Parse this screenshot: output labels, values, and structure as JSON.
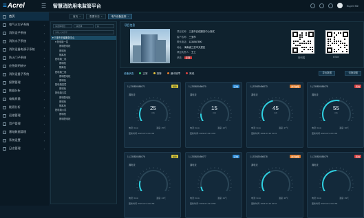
{
  "header": {
    "logo_prefix": "≡",
    "logo": "Acrel",
    "title": "智慧消防用电监管平台",
    "user": "Super Me"
  },
  "sidebar": [
    {
      "label": "首页",
      "arrow": ""
    },
    {
      "label": "电气火灾子系统",
      "arrow": "›"
    },
    {
      "label": "消防设子系统",
      "arrow": "›"
    },
    {
      "label": "消防水子系统",
      "arrow": "›"
    },
    {
      "label": "消防设备电源子系统",
      "arrow": "›"
    },
    {
      "label": "防火门子系统",
      "arrow": "›"
    },
    {
      "label": "应急照明统计",
      "arrow": "›"
    },
    {
      "label": "消防设备子系统",
      "arrow": "›"
    },
    {
      "label": "报警管理",
      "arrow": "›"
    },
    {
      "label": "数据分析",
      "arrow": "›"
    },
    {
      "label": "电能质量",
      "arrow": "›"
    },
    {
      "label": "能源分析",
      "arrow": "›"
    },
    {
      "label": "运维管理",
      "arrow": "›"
    },
    {
      "label": "用户管理",
      "arrow": "›"
    },
    {
      "label": "基础数据管理",
      "arrow": "›"
    },
    {
      "label": "系统设置",
      "arrow": "›"
    },
    {
      "label": "日志管理",
      "arrow": "›"
    }
  ],
  "tabs": [
    {
      "label": "首页"
    },
    {
      "label": "配置状态"
    },
    {
      "label": "电气设备监测"
    }
  ],
  "tree": {
    "filters": [
      "请选择项目",
      "请选择",
      "请"
    ],
    "search_placeholder": "请输入关键字",
    "nodes": [
      {
        "label": "▾ 三亚市白保服务中心",
        "indent": 2,
        "sel": true
      },
      {
        "label": "▾ 配电箱一层",
        "indent": 6
      },
      {
        "label": "照明配电柜",
        "indent": 12
      },
      {
        "label": "照明柜",
        "indent": 12
      },
      {
        "label": "隔离柜",
        "indent": 12
      },
      {
        "label": "配电箱二层",
        "indent": 6
      },
      {
        "label": "照明柜",
        "indent": 12
      },
      {
        "label": "隔离柜",
        "indent": 12
      },
      {
        "label": "配电箱三层",
        "indent": 6
      },
      {
        "label": "照明配电柜",
        "indent": 12
      },
      {
        "label": "照明柜",
        "indent": 12
      },
      {
        "label": "配电箱四层",
        "indent": 6
      },
      {
        "label": "照明柜",
        "indent": 12
      },
      {
        "label": "配电箱五层",
        "indent": 6
      },
      {
        "label": "照明配电柜",
        "indent": 12
      },
      {
        "label": "照明柜",
        "indent": 12
      },
      {
        "label": "隔离柜",
        "indent": 12
      },
      {
        "label": "配电箱六层",
        "indent": 6
      },
      {
        "label": "照明柜",
        "indent": 12
      },
      {
        "label": "照明配电柜",
        "indent": 12
      }
    ]
  },
  "info": {
    "title": "项目信息",
    "rows": [
      {
        "k": "项目名称:",
        "v": "三亚市白保服务中心测试"
      },
      {
        "k": "客户名称:",
        "v": "三亚市"
      },
      {
        "k": "联系电话:",
        "v": "1234567890"
      },
      {
        "k": "地址:",
        "v": "海南省三亚市天涯区"
      },
      {
        "k": "项目负责人:",
        "v": "王工"
      },
      {
        "k": "状态:",
        "v": "正常"
      }
    ],
    "qr1_caption": "安科瑞",
    "qr2_caption": "ESIM"
  },
  "status": {
    "label": "设备状态",
    "legend": [
      {
        "label": "正常",
        "color": "#3cc86b"
      },
      {
        "label": "报警",
        "color": "#e7c33a"
      },
      {
        "label": "通讯故障",
        "color": "#e07b2a"
      },
      {
        "label": "离线",
        "color": "#d94040"
      }
    ],
    "btn_export": "导出数据",
    "btn_switch": "切换视图"
  },
  "cards": [
    {
      "title": "1 | 230820456071",
      "badge": "报警",
      "btype": "ok",
      "label": "漏电流",
      "value": "25",
      "unit": "mA",
      "frac": 0.25,
      "r1": "电流: 0mA",
      "r2": "温度: 25℃",
      "r3": "更新时间: 2023-07-24 11:03"
    },
    {
      "title": "1 | 230820456070",
      "badge": "正常",
      "btype": "cm",
      "label": "漏电流",
      "value": "15",
      "unit": "mA",
      "frac": 0.15,
      "r1": "电流: 0mA",
      "r2": "温度: 22℃",
      "r3": "更新时间: 2023-07-24 11:02"
    },
    {
      "title": "1 | 230820456073",
      "badge": "通讯故障",
      "btype": "or",
      "label": "漏电流",
      "value": "45",
      "unit": "mA",
      "frac": 0.45,
      "r1": "电流: 0mA",
      "r2": "温度: 27℃",
      "r3": "更新时间: 2023-07-24 11:01"
    },
    {
      "title": "1 | 230820456075",
      "badge": "离线",
      "btype": "rd",
      "label": "漏电流",
      "value": "55",
      "unit": "mA",
      "frac": 0.55,
      "r1": "电流: 0mA",
      "r2": "温度: 30℃",
      "r3": "更新时间: 2023-07-24 11:00"
    },
    {
      "title": "1 | 230820456076",
      "badge": "报警",
      "btype": "ok",
      "label": "漏电流",
      "value": "",
      "unit": "",
      "frac": 0.2,
      "r1": "电流: 0mA",
      "r2": "温度: 24℃",
      "r3": "更新时间: 2023-07-24 10:59"
    },
    {
      "title": "1 | 230820456077",
      "badge": "正常",
      "btype": "cm",
      "label": "漏电流",
      "value": "",
      "unit": "",
      "frac": 0.1,
      "r1": "电流: 0mA",
      "r2": "温度: 21℃",
      "r3": "更新时间: 2023-07-24 10:58"
    },
    {
      "title": "1 | 230820456078",
      "badge": "通讯故障",
      "btype": "or",
      "label": "漏电流",
      "value": "",
      "unit": "",
      "frac": 0.4,
      "r1": "电流: 0mA",
      "r2": "温度: 26℃",
      "r3": "更新时间: 2023-07-24 10:57"
    },
    {
      "title": "1 | 230820456079",
      "badge": "离线",
      "btype": "rd",
      "label": "漏电流",
      "value": "",
      "unit": "",
      "frac": 0.5,
      "r1": "电流: 0mA",
      "r2": "温度: 29℃",
      "r3": "更新时间: 2023-07-24 10:56"
    }
  ]
}
